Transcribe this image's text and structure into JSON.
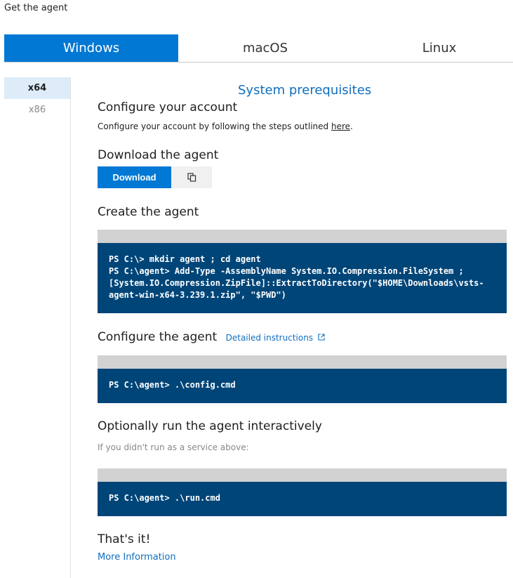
{
  "panel": {
    "title": "Get the agent"
  },
  "os_tabs": [
    {
      "label": "Windows",
      "active": true
    },
    {
      "label": "macOS",
      "active": false
    },
    {
      "label": "Linux",
      "active": false
    }
  ],
  "arch_items": [
    {
      "label": "x64",
      "active": true
    },
    {
      "label": "x86",
      "active": false
    }
  ],
  "content": {
    "prereq_link": "System prerequisites",
    "configure_account": {
      "title": "Configure your account",
      "text_before": "Configure your account by following the steps outlined ",
      "link": "here",
      "text_after": "."
    },
    "download": {
      "title": "Download the agent",
      "button_label": "Download",
      "copy_icon": "copy-icon"
    },
    "create": {
      "title": "Create the agent",
      "code": "PS C:\\> mkdir agent ; cd agent\nPS C:\\agent> Add-Type -AssemblyName System.IO.Compression.FileSystem ;\n[System.IO.Compression.ZipFile]::ExtractToDirectory(\"$HOME\\Downloads\\vsts-\nagent-win-x64-3.239.1.zip\", \"$PWD\")"
    },
    "configure_agent": {
      "title": "Configure the agent",
      "link": "Detailed instructions",
      "link_icon": "external-link-icon",
      "code": "PS C:\\agent> .\\config.cmd"
    },
    "run_agent": {
      "title": "Optionally run the agent interactively",
      "hint": "If you didn't run as a service above:",
      "code": "PS C:\\agent> .\\run.cmd"
    },
    "finish": {
      "title": "That's it!",
      "more_link": "More Information"
    }
  },
  "colors": {
    "accent": "#0078d4",
    "code_bg": "#004578",
    "code_header": "#d2d2d2",
    "link": "#106ebe"
  }
}
